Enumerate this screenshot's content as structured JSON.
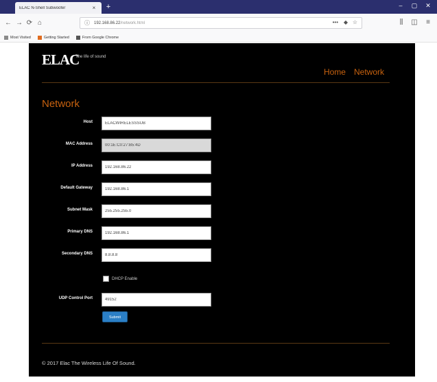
{
  "browser": {
    "tab_title": "ELAC N-Shell Subwoofer",
    "tab_close": "×",
    "new_tab": "+",
    "url": "192.168.86.22",
    "url_path": "/network.html",
    "bookmarks": [
      {
        "label": "Most Visited",
        "color": "#8a8a8a"
      },
      {
        "label": "Getting Started",
        "color": "#e06b1f"
      },
      {
        "label": "From Google Chrome",
        "color": "#555555"
      }
    ]
  },
  "site": {
    "logo": "ELAC",
    "tagline": "The life of sound",
    "nav": [
      "Home",
      "Network"
    ],
    "heading": "Network",
    "accent_color": "#c8620f"
  },
  "form": {
    "fields": [
      {
        "label": "Host",
        "value": "ELACWIRELESSSUB",
        "readonly": false
      },
      {
        "label": "MAC Address",
        "value": "00:1E:C0:27:B5:4D",
        "readonly": true
      },
      {
        "label": "IP Address",
        "value": "192.168.86.22",
        "readonly": false
      },
      {
        "label": "Default Gateway",
        "value": "192.168.86.1",
        "readonly": false
      },
      {
        "label": "Subnet Mask",
        "value": "255.255.255.0",
        "readonly": false
      },
      {
        "label": "Primary DNS",
        "value": "192.168.86.1",
        "readonly": false
      },
      {
        "label": "Secondary DNS",
        "value": "8.8.8.8",
        "readonly": false
      }
    ],
    "dhcp_label": "DHCP Enable",
    "udp": {
      "label": "UDP Control Port",
      "value": "49152"
    },
    "submit_label": "Submit"
  },
  "footer": "© 2017 Elac The Wireless Life Of Sound."
}
